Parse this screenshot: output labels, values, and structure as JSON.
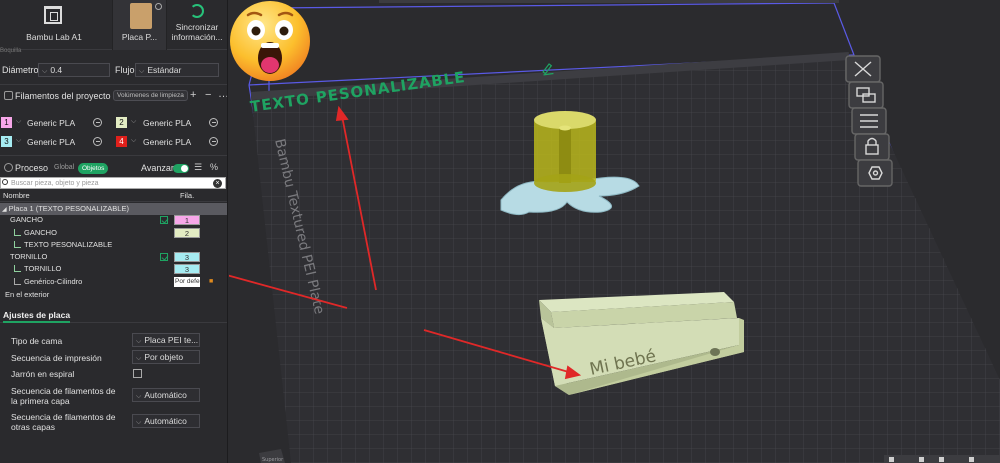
{
  "topbar": {
    "printer_label": "Bambu Lab A1",
    "plate_label": "Placa P...",
    "sync_label": "Sincronizar información...",
    "hidden_label": "Boquilla"
  },
  "nozzle": {
    "diameter_label": "Diámetro",
    "diameter_value": "0.4",
    "flow_label": "Flujo",
    "flow_value": "Estándar"
  },
  "filaments": {
    "header": "Filamentos del proyecto",
    "purge_label": "Volúmenes de limpieza",
    "add": "+",
    "remove": "−",
    "more": "…",
    "items": [
      {
        "slot": "1",
        "name": "Generic PLA",
        "color": "#f7a7e9"
      },
      {
        "slot": "2",
        "name": "Generic PLA",
        "color": "#e3ecc3"
      },
      {
        "slot": "3",
        "name": "Generic PLA",
        "color": "#a6ecf2"
      },
      {
        "slot": "4",
        "name": "Generic PLA",
        "color": "#e0201b"
      }
    ]
  },
  "process": {
    "header": "Proceso",
    "global_label": "Global",
    "objects_label": "Objetos",
    "advanced_label": "Avanzar",
    "search_placeholder": "Buscar pieza, objeto y pieza",
    "col_name": "Nombre",
    "col_fil": "Fila."
  },
  "tree": {
    "plate": "Placa 1 (TEXTO PESONALIZABLE)",
    "gancho": "GANCHO",
    "gancho_fil": "1",
    "gancho_part": "GANCHO",
    "gancho_part_fil": "2",
    "texto_part": "TEXTO PESONALIZABLE",
    "tornillo": "TORNILLO",
    "tornillo_fil": "3",
    "tornillo_part": "TORNILLO",
    "tornillo_part_fil": "3",
    "cylinder": "Genérico-Cilindro",
    "cylinder_fil": "Por defecto",
    "outside": "En el exterior"
  },
  "plate_settings": {
    "tab": "Ajustes de placa",
    "bed_type_label": "Tipo de cama",
    "bed_type_value": "Placa PEI te...",
    "print_seq_label": "Secuencia de impresión",
    "print_seq_value": "Por objeto",
    "spiral_label": "Jarrón en espiral",
    "first_layer_seq_label_1": "Secuencia de filamentos de",
    "first_layer_seq_label_2": "la primera capa",
    "first_layer_seq_value": "Automático",
    "other_layers_seq_label_1": "Secuencia de filamentos de",
    "other_layers_seq_label_2": "otras capas",
    "other_layers_seq_value": "Automático"
  },
  "scene": {
    "text_object": "TEXTO PESONALIZABLE",
    "bed_label": "Bambu Textured PEI Plate",
    "hook_text": "Mi bebé",
    "corner_label": "Superior",
    "accent": "#1fa362",
    "arrow_color": "#e02828",
    "box_color": "#5a5ae6"
  }
}
